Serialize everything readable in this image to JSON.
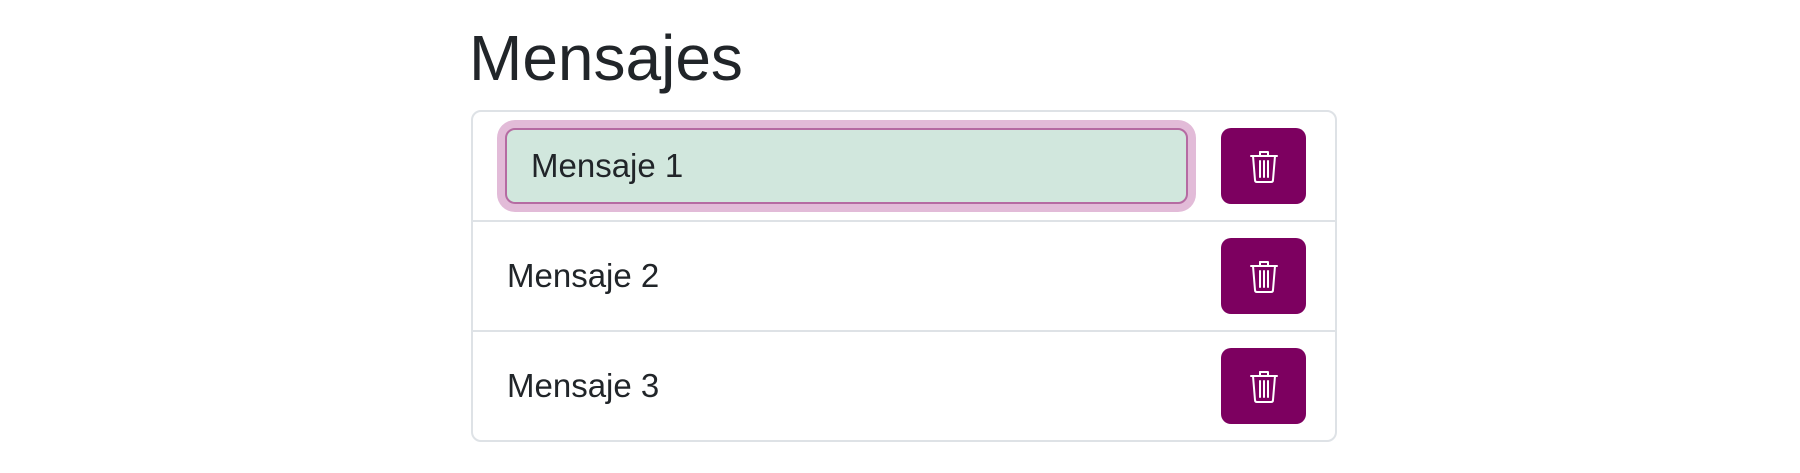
{
  "page": {
    "title": "Mensajes"
  },
  "messages": {
    "items": [
      {
        "text": "Mensaje 1",
        "editing": true
      },
      {
        "text": "Mensaje 2",
        "editing": false
      },
      {
        "text": "Mensaje 3",
        "editing": false
      }
    ],
    "delete_icon": "trash-icon"
  },
  "colors": {
    "delete_button_bg": "#7d0060",
    "input_bg": "#d1e7dd",
    "focus_ring": "#e2bbd8"
  }
}
